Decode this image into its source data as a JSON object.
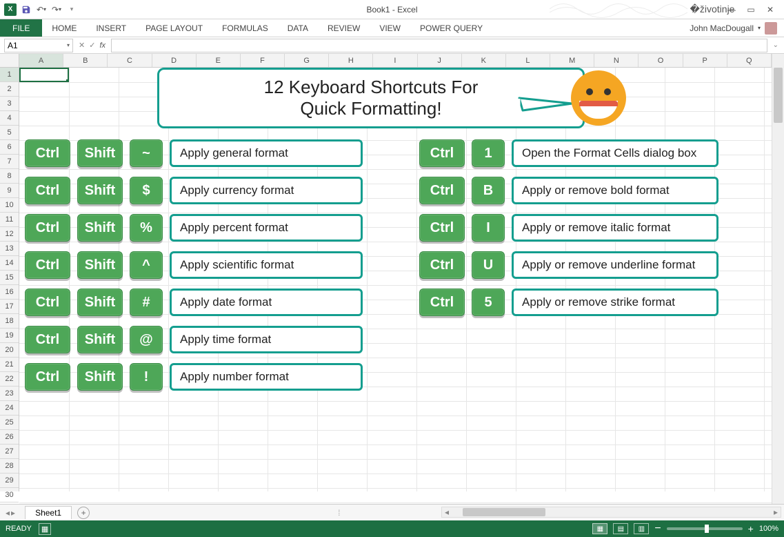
{
  "title": "Book1 - Excel",
  "user": "John MacDougall",
  "tabs": {
    "file": "FILE",
    "home": "HOME",
    "insert": "INSERT",
    "page_layout": "PAGE LAYOUT",
    "formulas": "FORMULAS",
    "data": "DATA",
    "review": "REVIEW",
    "view": "VIEW",
    "power_query": "POWER QUERY"
  },
  "namebox": "A1",
  "columns": [
    "A",
    "B",
    "C",
    "D",
    "E",
    "F",
    "G",
    "H",
    "I",
    "J",
    "K",
    "L",
    "M",
    "N",
    "O",
    "P",
    "Q"
  ],
  "rows": [
    "1",
    "2",
    "3",
    "4",
    "5",
    "6",
    "7",
    "8",
    "9",
    "10",
    "11",
    "12",
    "13",
    "14",
    "15",
    "16",
    "17",
    "18",
    "19",
    "20",
    "21",
    "22",
    "23",
    "24",
    "25",
    "26",
    "27",
    "28",
    "29",
    "30"
  ],
  "callout_line1": "12 Keyboard Shortcuts For",
  "callout_line2": "Quick Formatting!",
  "left_rows": [
    {
      "k1": "Ctrl",
      "k2": "Shift",
      "k3": "~",
      "desc": "Apply general format"
    },
    {
      "k1": "Ctrl",
      "k2": "Shift",
      "k3": "$",
      "desc": "Apply currency format"
    },
    {
      "k1": "Ctrl",
      "k2": "Shift",
      "k3": "%",
      "desc": "Apply percent format"
    },
    {
      "k1": "Ctrl",
      "k2": "Shift",
      "k3": "^",
      "desc": "Apply scientific format"
    },
    {
      "k1": "Ctrl",
      "k2": "Shift",
      "k3": "#",
      "desc": "Apply date format"
    },
    {
      "k1": "Ctrl",
      "k2": "Shift",
      "k3": "@",
      "desc": "Apply time format"
    },
    {
      "k1": "Ctrl",
      "k2": "Shift",
      "k3": "!",
      "desc": "Apply number format"
    }
  ],
  "right_rows": [
    {
      "k1": "Ctrl",
      "k2": "1",
      "desc": "Open the Format Cells dialog box"
    },
    {
      "k1": "Ctrl",
      "k2": "B",
      "desc": "Apply or remove bold format"
    },
    {
      "k1": "Ctrl",
      "k2": "I",
      "desc": "Apply or remove italic format"
    },
    {
      "k1": "Ctrl",
      "k2": "U",
      "desc": "Apply or remove underline format"
    },
    {
      "k1": "Ctrl",
      "k2": "5",
      "desc": "Apply or remove strike format"
    }
  ],
  "sheet_tab": "Sheet1",
  "status": {
    "ready": "READY",
    "zoom": "100%"
  }
}
